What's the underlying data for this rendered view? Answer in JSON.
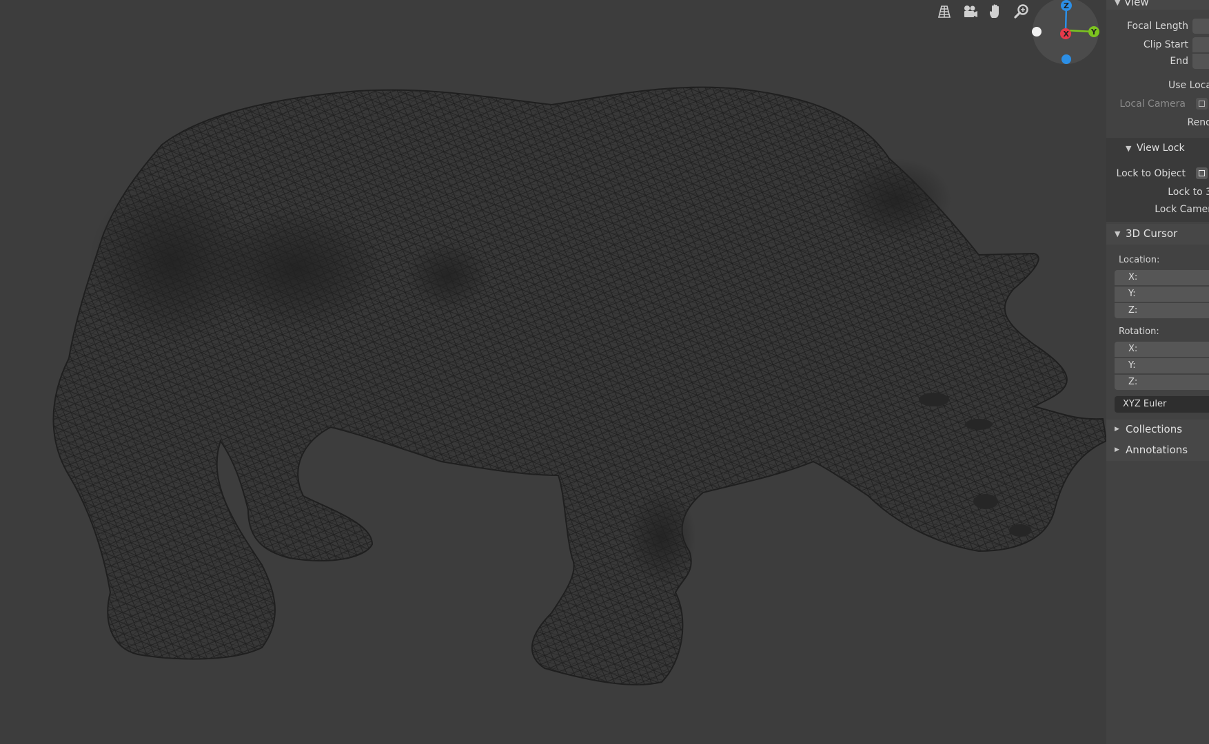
{
  "viewport": {
    "nav_icons": [
      {
        "name": "grid-view-icon"
      },
      {
        "name": "camera-view-icon"
      },
      {
        "name": "hand-pan-icon"
      },
      {
        "name": "zoom-icon"
      }
    ],
    "gizmo": {
      "x_label": "X",
      "y_label": "Y",
      "z_label": "Z",
      "x_color": "#e8394a",
      "y_color": "#7cc41f",
      "z_color": "#2c8fe6"
    },
    "model": "rhino-wireframe"
  },
  "sidebar": {
    "view_panel": {
      "title": "View",
      "focal_length_label": "Focal Length",
      "clip_start_label": "Clip Start",
      "end_label": "End",
      "use_local_label": "Use Loca",
      "local_camera_label": "Local Camera",
      "render_label": "Rend"
    },
    "view_lock": {
      "title": "View Lock",
      "lock_to_object_label": "Lock to Object",
      "lock_to_label": "Lock to 3",
      "lock_camera_label": "Lock Camer"
    },
    "cursor_panel": {
      "title": "3D Cursor",
      "location_label": "Location:",
      "location_axes": [
        "X:",
        "Y:",
        "Z:"
      ],
      "rotation_label": "Rotation:",
      "rotation_axes": [
        "X:",
        "Y:",
        "Z:"
      ],
      "rotation_mode": "XYZ Euler"
    },
    "collections_title": "Collections",
    "annotations_title": "Annotations"
  }
}
